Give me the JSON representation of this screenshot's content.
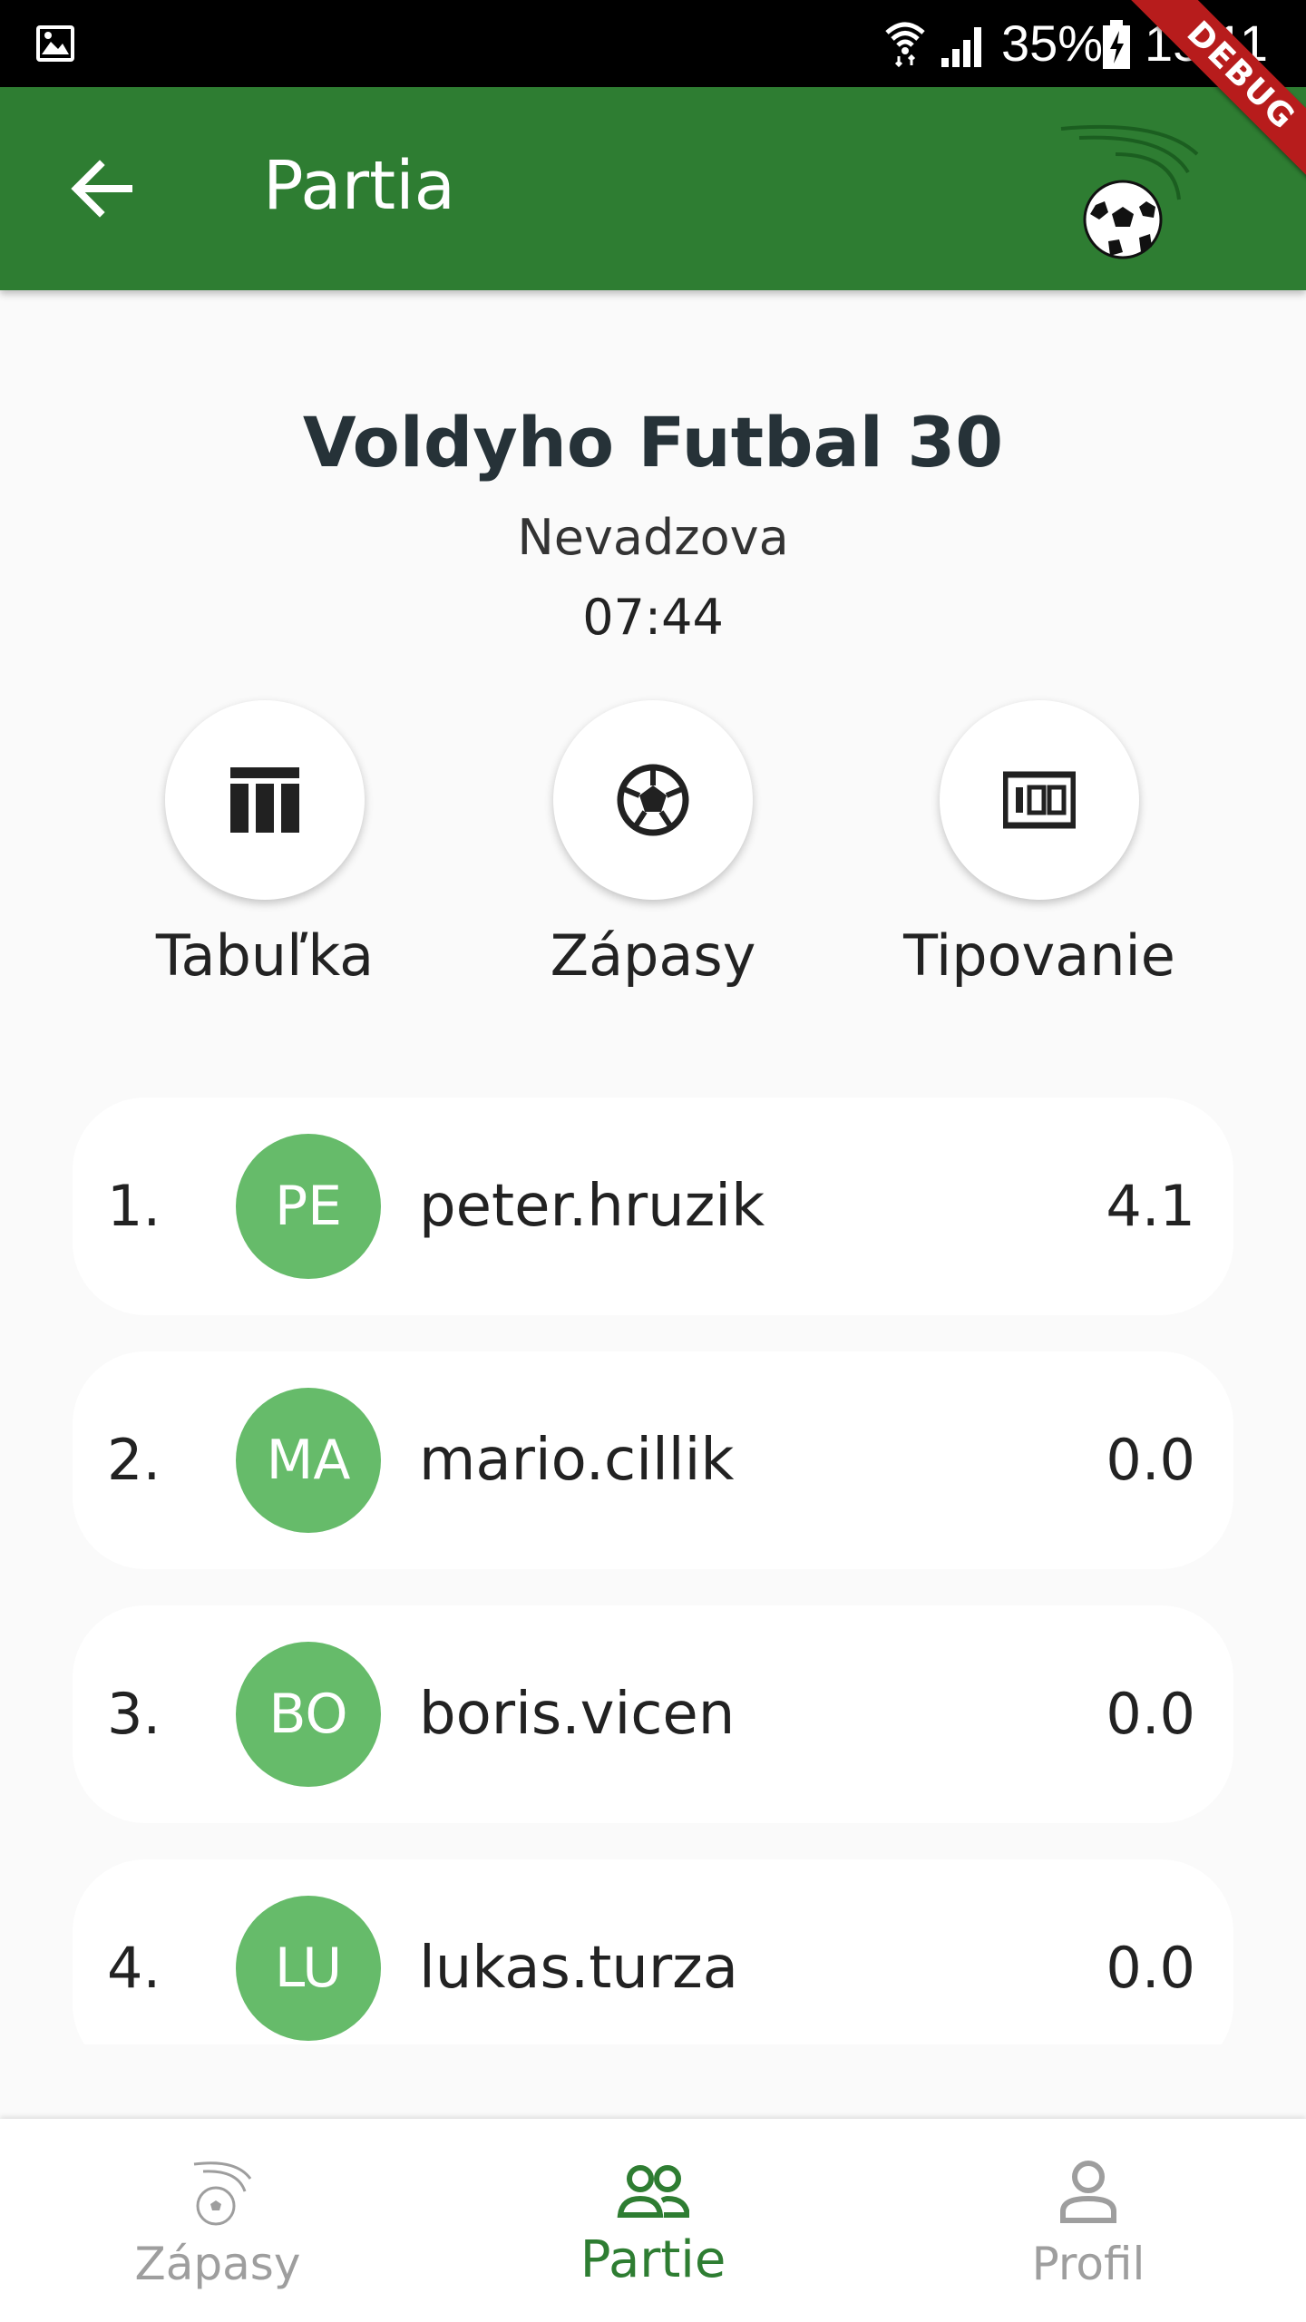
{
  "status_bar": {
    "battery_percent": "35%",
    "time": "15:11",
    "icons": [
      "gallery-icon",
      "wifi-icon",
      "signal-icon",
      "battery-charging-icon"
    ]
  },
  "app_bar": {
    "title": "Partia",
    "debug_label": "DEBUG",
    "background_color": "#2e7d32"
  },
  "league": {
    "name": "Voldyho Futbal 30",
    "location": "Nevadzova",
    "time": "07:44"
  },
  "actions": [
    {
      "label": "Tabuľka",
      "icon": "table-icon"
    },
    {
      "label": "Zápasy",
      "icon": "soccer-ball-icon"
    },
    {
      "label": "Tipovanie",
      "icon": "scoreboard-icon"
    }
  ],
  "ranking": [
    {
      "rank": "1.",
      "initials": "PE",
      "name": "peter.hruzik",
      "points": "4.1"
    },
    {
      "rank": "2.",
      "initials": "MA",
      "name": "mario.cillik",
      "points": "0.0"
    },
    {
      "rank": "3.",
      "initials": "BO",
      "name": "boris.vicen",
      "points": "0.0"
    },
    {
      "rank": "4.",
      "initials": "LU",
      "name": "lukas.turza",
      "points": "0.0"
    }
  ],
  "bottom_nav": {
    "items": [
      {
        "label": "Zápasy",
        "icon": "soccer-logo-icon",
        "active": false
      },
      {
        "label": "Partie",
        "icon": "group-icon",
        "active": true
      },
      {
        "label": "Profil",
        "icon": "person-icon",
        "active": false
      }
    ],
    "active_color": "#2e7d32",
    "inactive_color": "#9e9e9e"
  },
  "colors": {
    "avatar": "#66bb6a",
    "primary": "#2e7d32"
  }
}
